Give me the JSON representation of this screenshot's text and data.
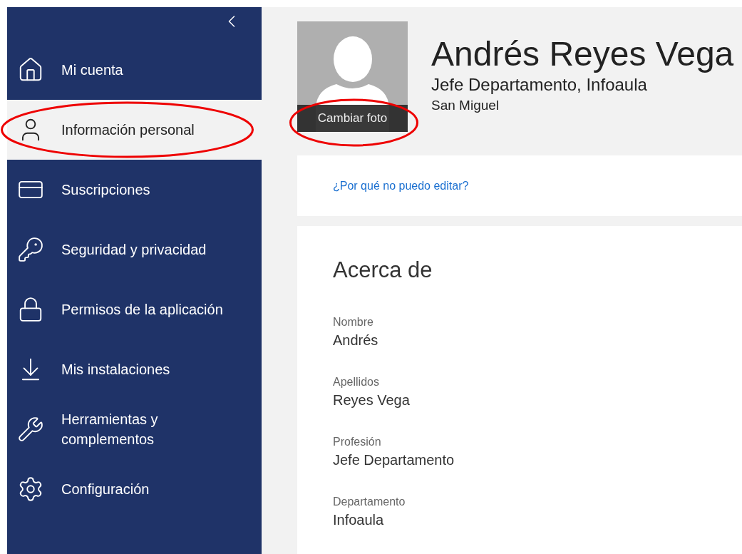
{
  "sidebar": {
    "items": [
      {
        "label": "Mi cuenta",
        "selected": false,
        "highlighted": false
      },
      {
        "label": "Información personal",
        "selected": true,
        "highlighted": true
      },
      {
        "label": "Suscripciones",
        "selected": false,
        "highlighted": false
      },
      {
        "label": "Seguridad y privacidad",
        "selected": false,
        "highlighted": false
      },
      {
        "label": "Permisos de la aplicación",
        "selected": false,
        "highlighted": false
      },
      {
        "label": "Mis instalaciones",
        "selected": false,
        "highlighted": false
      },
      {
        "label": "Herramientas y complementos",
        "selected": false,
        "highlighted": false
      },
      {
        "label": "Configuración",
        "selected": false,
        "highlighted": false
      }
    ]
  },
  "profile": {
    "name": "Andrés Reyes Vega",
    "title": "Jefe Departamento, Infoaula",
    "location": "San Miguel",
    "photo_button": {
      "label": "Cambiar foto",
      "highlighted": true
    }
  },
  "edit_link": "¿Por qué no puedo editar?",
  "about": {
    "heading": "Acerca de",
    "fields": [
      {
        "label": "Nombre",
        "value": "Andrés"
      },
      {
        "label": "Apellidos",
        "value": "Reyes Vega"
      },
      {
        "label": "Profesión",
        "value": "Jefe Departamento"
      },
      {
        "label": "Departamento",
        "value": "Infoaula"
      }
    ]
  }
}
